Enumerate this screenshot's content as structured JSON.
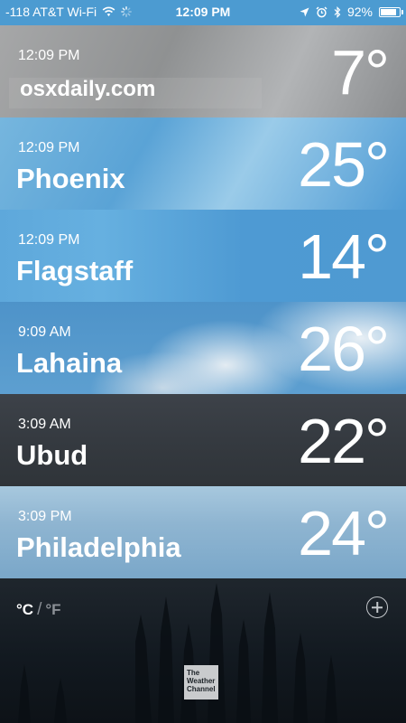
{
  "status_bar": {
    "carrier": "-118 AT&T Wi-Fi",
    "time": "12:09 PM",
    "battery": "92%",
    "battery_level": 0.92
  },
  "cities": [
    {
      "time": "12:09 PM",
      "name": "osxdaily.com",
      "temp": "7°"
    },
    {
      "time": "12:09 PM",
      "name": "Phoenix",
      "temp": "25°"
    },
    {
      "time": "12:09 PM",
      "name": "Flagstaff",
      "temp": "14°"
    },
    {
      "time": "9:09 AM",
      "name": "Lahaina",
      "temp": "26°"
    },
    {
      "time": "3:09 AM",
      "name": "Ubud",
      "temp": "22°"
    },
    {
      "time": "3:09 PM",
      "name": "Philadelphia",
      "temp": "24°"
    }
  ],
  "footer": {
    "unit_celsius": "°C",
    "unit_separator": "/",
    "unit_fahrenheit": "°F",
    "logo_lines": [
      "The",
      "Weather",
      "Channel"
    ]
  },
  "icons": {
    "wifi": "wifi-icon",
    "loading": "activity-spinner-icon",
    "location": "location-arrow-icon",
    "alarm": "alarm-icon",
    "bluetooth": "bluetooth-icon",
    "battery": "battery-icon",
    "add": "add-circle-icon"
  }
}
